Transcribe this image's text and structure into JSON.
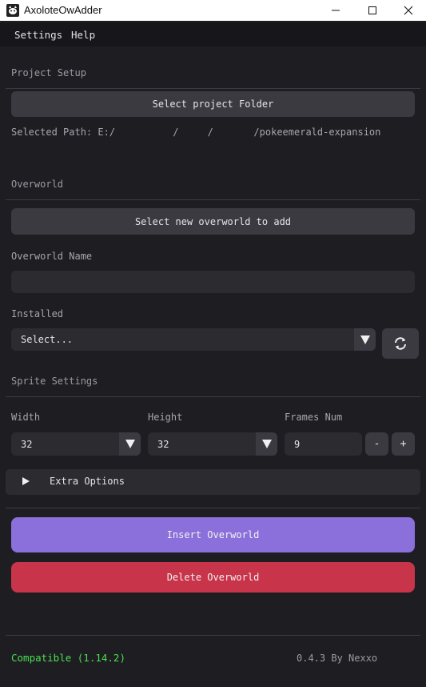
{
  "window": {
    "title": "AxoloteOwAdder",
    "icon": "axolotl-app-icon"
  },
  "menu": {
    "items": [
      "Settings",
      "Help"
    ]
  },
  "project_setup": {
    "section_label": "Project Setup",
    "select_folder_label": "Select project Folder",
    "selected_path_text": "Selected Path: E:/          /     /       /pokeemerald-expansion"
  },
  "overworld": {
    "section_label": "Overworld",
    "select_new_label": "Select new overworld to add",
    "name_label": "Overworld Name",
    "name_value": "",
    "installed_label": "Installed",
    "installed_selected": "Select..."
  },
  "sprite": {
    "section_label": "Sprite Settings",
    "width_label": "Width",
    "width_value": "32",
    "height_label": "Height",
    "height_value": "32",
    "frames_label": "Frames Num",
    "frames_value": "9",
    "minus_label": "-",
    "plus_label": "+"
  },
  "extra_options": {
    "label": "Extra Options",
    "expanded": false
  },
  "actions": {
    "insert_label": "Insert Overworld",
    "delete_label": "Delete Overworld",
    "insert_color": "#8b70db",
    "delete_color": "#c8344a"
  },
  "footer": {
    "compat_text": "Compatible (1.14.2)",
    "version_text": "0.4.3 By Nexxo"
  }
}
